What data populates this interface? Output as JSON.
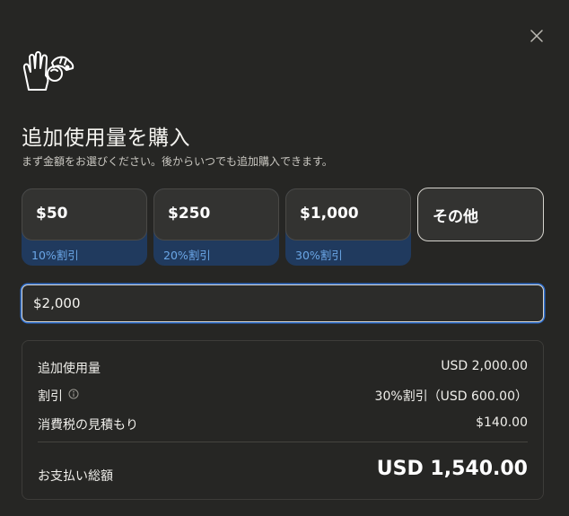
{
  "title": "追加使用量を購入",
  "subtitle": "まず金額をお選びください。後からいつでも追加購入できます。",
  "options": [
    {
      "amount": "$50",
      "discount": "10%割引"
    },
    {
      "amount": "$250",
      "discount": "20%割引"
    },
    {
      "amount": "$1,000",
      "discount": "30%割引"
    }
  ],
  "other_label": "その他",
  "custom_amount_value": "$2,000",
  "summary": {
    "usage_label": "追加使用量",
    "usage_value": "USD 2,000.00",
    "discount_label": "割引",
    "discount_value": "30%割引（USD 600.00）",
    "tax_label": "消費税の見積もり",
    "tax_value": "$140.00",
    "total_label": "お支払い総額",
    "total_value": "USD 1,540.00"
  },
  "colors": {
    "background": "#262624",
    "discount_band": "#203a5e",
    "discount_text": "#6aa6e6",
    "focus_ring": "#2f6fcf"
  },
  "icons": {
    "close": "close-icon",
    "header": "hand-illustration-icon",
    "info": "info-icon"
  }
}
